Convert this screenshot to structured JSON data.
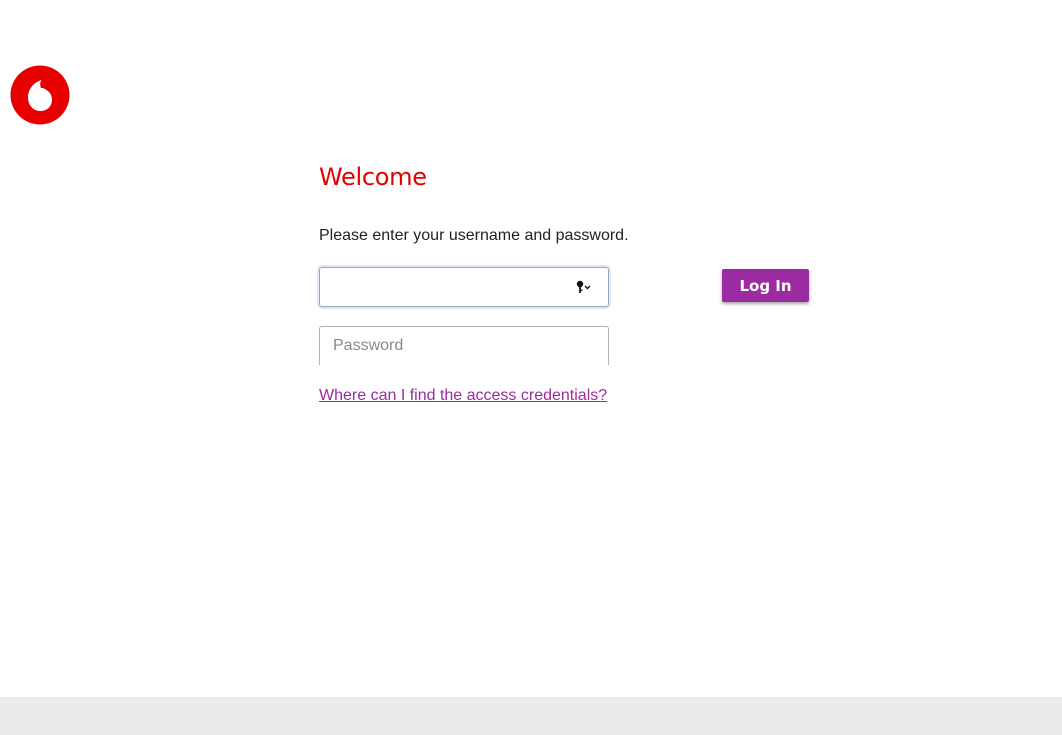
{
  "brand": {
    "logo_icon": "vodafone-speechmark-logo",
    "primary_color": "#e60000",
    "accent_color": "#9c2aa0"
  },
  "login": {
    "title": "Welcome",
    "instructions": "Please enter your username and password.",
    "username": {
      "value": "",
      "autofill_icon": "key-dropdown-icon"
    },
    "password": {
      "value": "",
      "placeholder": "Password"
    },
    "submit_label": "Log In",
    "help_link": "Where can I find the access credentials?"
  }
}
